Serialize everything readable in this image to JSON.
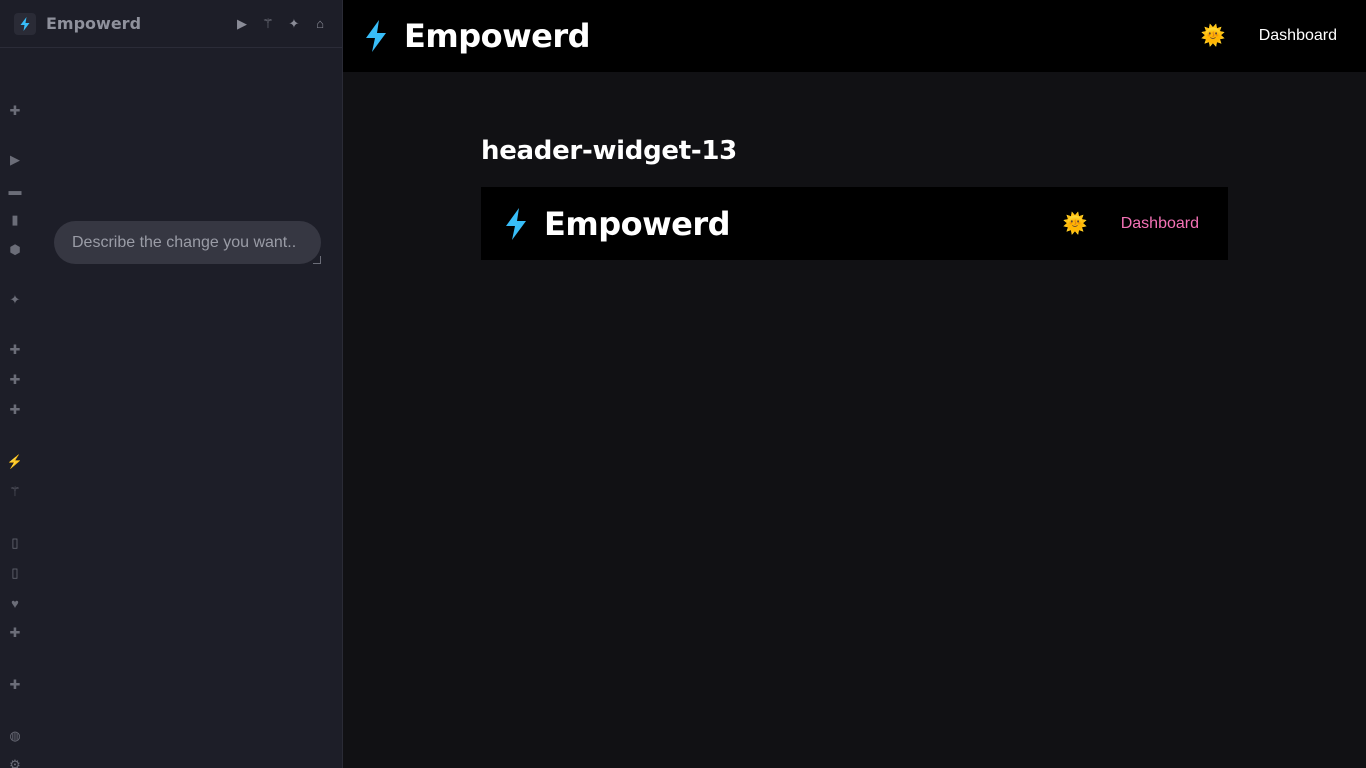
{
  "sidebar": {
    "title": "Empowerd",
    "tools": [
      {
        "icon": "play-icon",
        "glyph": "▶"
      },
      {
        "icon": "magic-wand-icon",
        "glyph": "⚚"
      },
      {
        "icon": "sparkles-icon",
        "glyph": "✦"
      },
      {
        "icon": "home-icon",
        "glyph": "⌂"
      }
    ],
    "rail_icons": [
      {
        "icon": "puzzle-icon",
        "glyph": "✚"
      },
      {
        "icon": "play-icon",
        "glyph": "▶"
      },
      {
        "icon": "card-icon",
        "glyph": "▬"
      },
      {
        "icon": "document-icon",
        "glyph": "▮"
      },
      {
        "icon": "cube-icon",
        "glyph": "⬢"
      },
      {
        "icon": "sparkles-icon",
        "glyph": "✦"
      },
      {
        "icon": "puzzle-icon",
        "glyph": "✚"
      },
      {
        "icon": "puzzle-icon",
        "glyph": "✚"
      },
      {
        "icon": "puzzle-icon",
        "glyph": "✚"
      },
      {
        "icon": "plug-icon",
        "glyph": "⚡"
      },
      {
        "icon": "magic-wand-icon",
        "glyph": "⚚"
      },
      {
        "icon": "database-icon",
        "glyph": "▯"
      },
      {
        "icon": "database-icon",
        "glyph": "▯"
      },
      {
        "icon": "heart-icon",
        "glyph": "♥"
      },
      {
        "icon": "puzzle-icon",
        "glyph": "✚"
      },
      {
        "icon": "puzzle-icon",
        "glyph": "✚"
      },
      {
        "icon": "globe-icon",
        "glyph": "◍"
      },
      {
        "icon": "gear-icon",
        "glyph": "⚙"
      }
    ],
    "prompt_placeholder": "Describe the change you want.."
  },
  "header": {
    "brand": "Empowerd",
    "theme_icon": "🌞",
    "nav_link": "Dashboard"
  },
  "main": {
    "heading": "header-widget-13",
    "preview": {
      "brand": "Empowerd",
      "theme_icon": "🌞",
      "nav_link": "Dashboard"
    }
  },
  "colors": {
    "accent_bolt": "#38bdf8",
    "preview_link": "#f472b6",
    "sidebar_bg": "#1d1e28",
    "main_bg": "#111114"
  }
}
